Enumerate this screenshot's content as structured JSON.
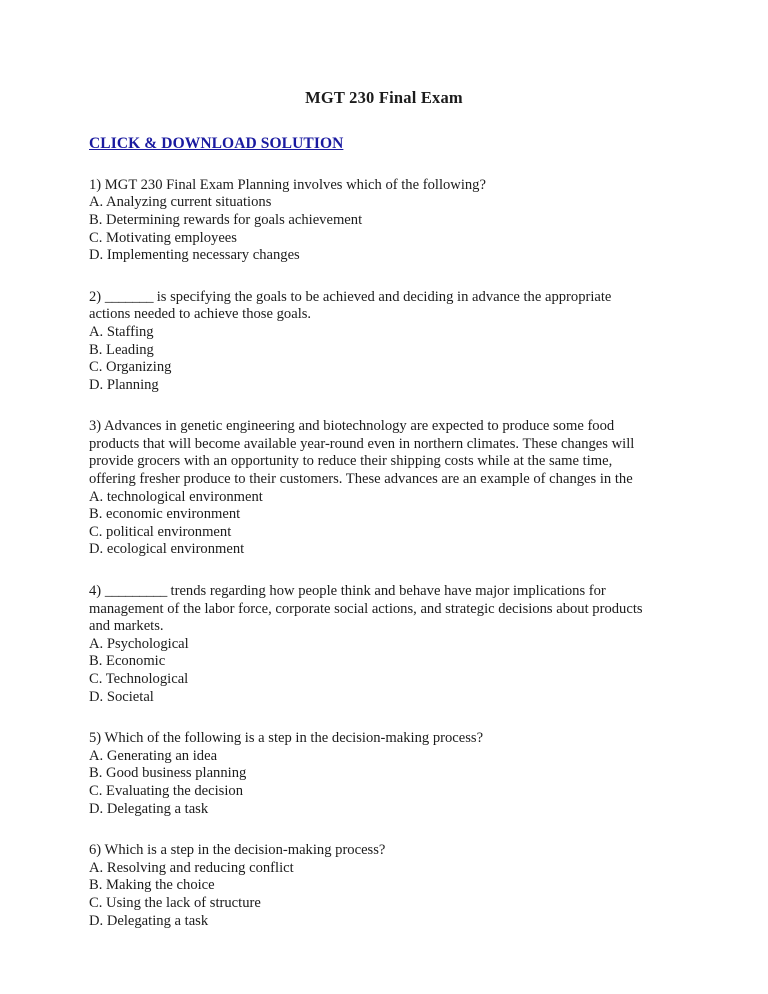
{
  "document": {
    "title": "MGT 230 Final Exam",
    "solution_link": "CLICK & DOWNLOAD SOLUTION",
    "link_color": "#1a1aa0",
    "questions": [
      {
        "stem": "1) MGT 230 Final Exam Planning involves which of the following?",
        "options": [
          "A. Analyzing current situations",
          "B. Determining rewards for goals achievement",
          "C. Motivating employees",
          "D. Implementing necessary changes"
        ]
      },
      {
        "stem_before_blank": "2) ",
        "blank": "_______",
        "stem_after_blank": " is specifying the goals to be achieved and deciding in advance the appropriate actions needed to achieve those goals.",
        "options": [
          "A. Staffing",
          "B. Leading",
          "C. Organizing",
          "D. Planning"
        ]
      },
      {
        "stem": "3) Advances in genetic engineering and biotechnology are expected to produce some food products that will become available year-round even in northern climates. These changes will provide grocers with an opportunity to reduce their shipping costs while at the same time, offering fresher produce to their customers. These advances are an example of changes in the",
        "options": [
          "A. technological environment",
          "B. economic environment",
          "C. political environment",
          "D. ecological environment"
        ]
      },
      {
        "stem_before_blank": "4) ",
        "blank": "_________",
        "stem_after_blank": " trends regarding how people think and behave have major implications for management of the labor force, corporate social actions, and strategic decisions about products and markets.",
        "options": [
          "A. Psychological",
          "B. Economic",
          "C. Technological",
          "D. Societal"
        ]
      },
      {
        "stem": "5) Which of the following is a step in the decision-making process?",
        "options": [
          "A. Generating an idea",
          "B. Good business planning",
          "C. Evaluating the decision",
          "D. Delegating a task"
        ]
      },
      {
        "stem": "6) Which is a step in the decision-making process?",
        "options": [
          "A. Resolving and reducing conflict",
          "B. Making the choice",
          "C. Using the lack of structure",
          "D. Delegating a task"
        ]
      }
    ]
  }
}
